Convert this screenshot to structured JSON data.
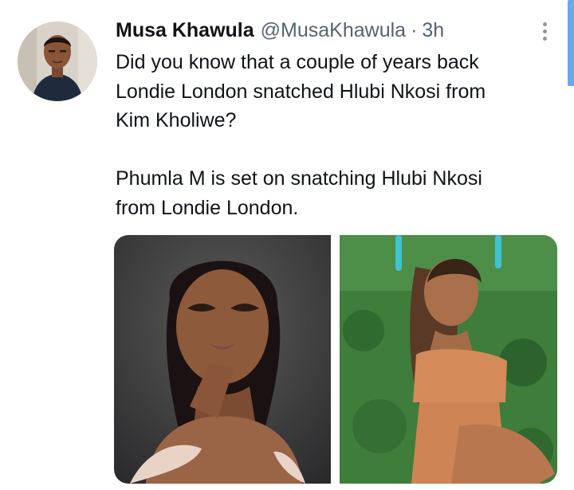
{
  "tweet": {
    "author_name": "Musa Khawula",
    "author_handle": "@MusaKhawula",
    "separator": "·",
    "timestamp": "3h",
    "text_lines": [
      "Did you know that a couple of years back",
      "Londie London snatched Hlubi Nkosi from",
      "Kim Kholiwe?",
      "",
      "Phumla M is set on snatching Hlubi Nkosi",
      "from Londie London."
    ],
    "media": [
      {
        "kind": "photo",
        "subject": "woman portrait, dark background"
      },
      {
        "kind": "photo",
        "subject": "woman in orange outfit, green leaf wall"
      }
    ]
  },
  "icons": {
    "more": "more-vertical-icon"
  },
  "colors": {
    "text": "#0f1419",
    "secondary": "#536471",
    "scroll_accent": "#6aa8f0"
  }
}
